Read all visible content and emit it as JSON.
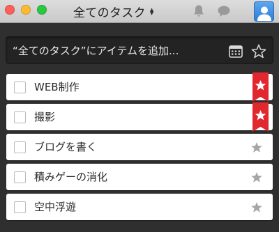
{
  "titlebar": {
    "title": "全てのタスク",
    "caret_up": "▲",
    "caret_down": "▼",
    "icons": {
      "bell": "bell-icon",
      "comment": "comment-icon",
      "avatar": "user-icon"
    }
  },
  "add_bar": {
    "placeholder": "“全てのタスク”にアイテムを追加...",
    "icons": {
      "calendar": "calendar-icon",
      "star": "star-outline-icon"
    }
  },
  "tasks": [
    {
      "title": "WEB制作",
      "starred": true
    },
    {
      "title": "撮影",
      "starred": true
    },
    {
      "title": "ブログを書く",
      "starred": false
    },
    {
      "title": "積みゲーの消化",
      "starred": false
    },
    {
      "title": "空中浮遊",
      "starred": false
    }
  ],
  "colors": {
    "ribbon_red": "#e0282e",
    "star_gray": "#a6a6a6",
    "window_bg": "#2f2f2f",
    "avatar_blue": "#3d8fe3"
  }
}
